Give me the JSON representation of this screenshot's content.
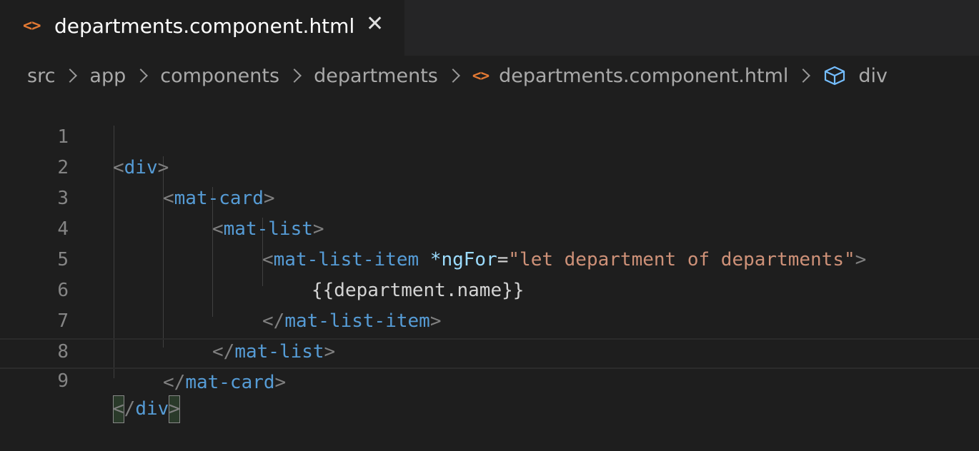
{
  "tab": {
    "icon": "<>",
    "title": "departments.component.html",
    "close": "✕"
  },
  "breadcrumbs": {
    "items": [
      "src",
      "app",
      "components",
      "departments"
    ],
    "file_icon": "<>",
    "file": "departments.component.html",
    "symbol_icon": "cube-icon",
    "symbol": "div"
  },
  "editor": {
    "line_numbers": [
      "1",
      "2",
      "3",
      "4",
      "5",
      "6",
      "7",
      "8",
      "9"
    ],
    "tokens": {
      "lt": "<",
      "gt": ">",
      "lt_slash": "</",
      "div": "div",
      "mat_card": "mat-card",
      "mat_list": "mat-list",
      "mat_list_item": "mat-list-item",
      "ng_for": "*ngFor",
      "eq": "=",
      "ng_for_value": "\"let department of departments\"",
      "interpolation": "{{department.name}}"
    }
  },
  "colors": {
    "background": "#1e1e1e",
    "tab_bar": "#252526",
    "file_icon": "#e37933",
    "tag": "#569cd6",
    "attribute": "#9cdcfe",
    "string": "#ce9178",
    "punctuation": "#808080",
    "line_number": "#858585"
  }
}
